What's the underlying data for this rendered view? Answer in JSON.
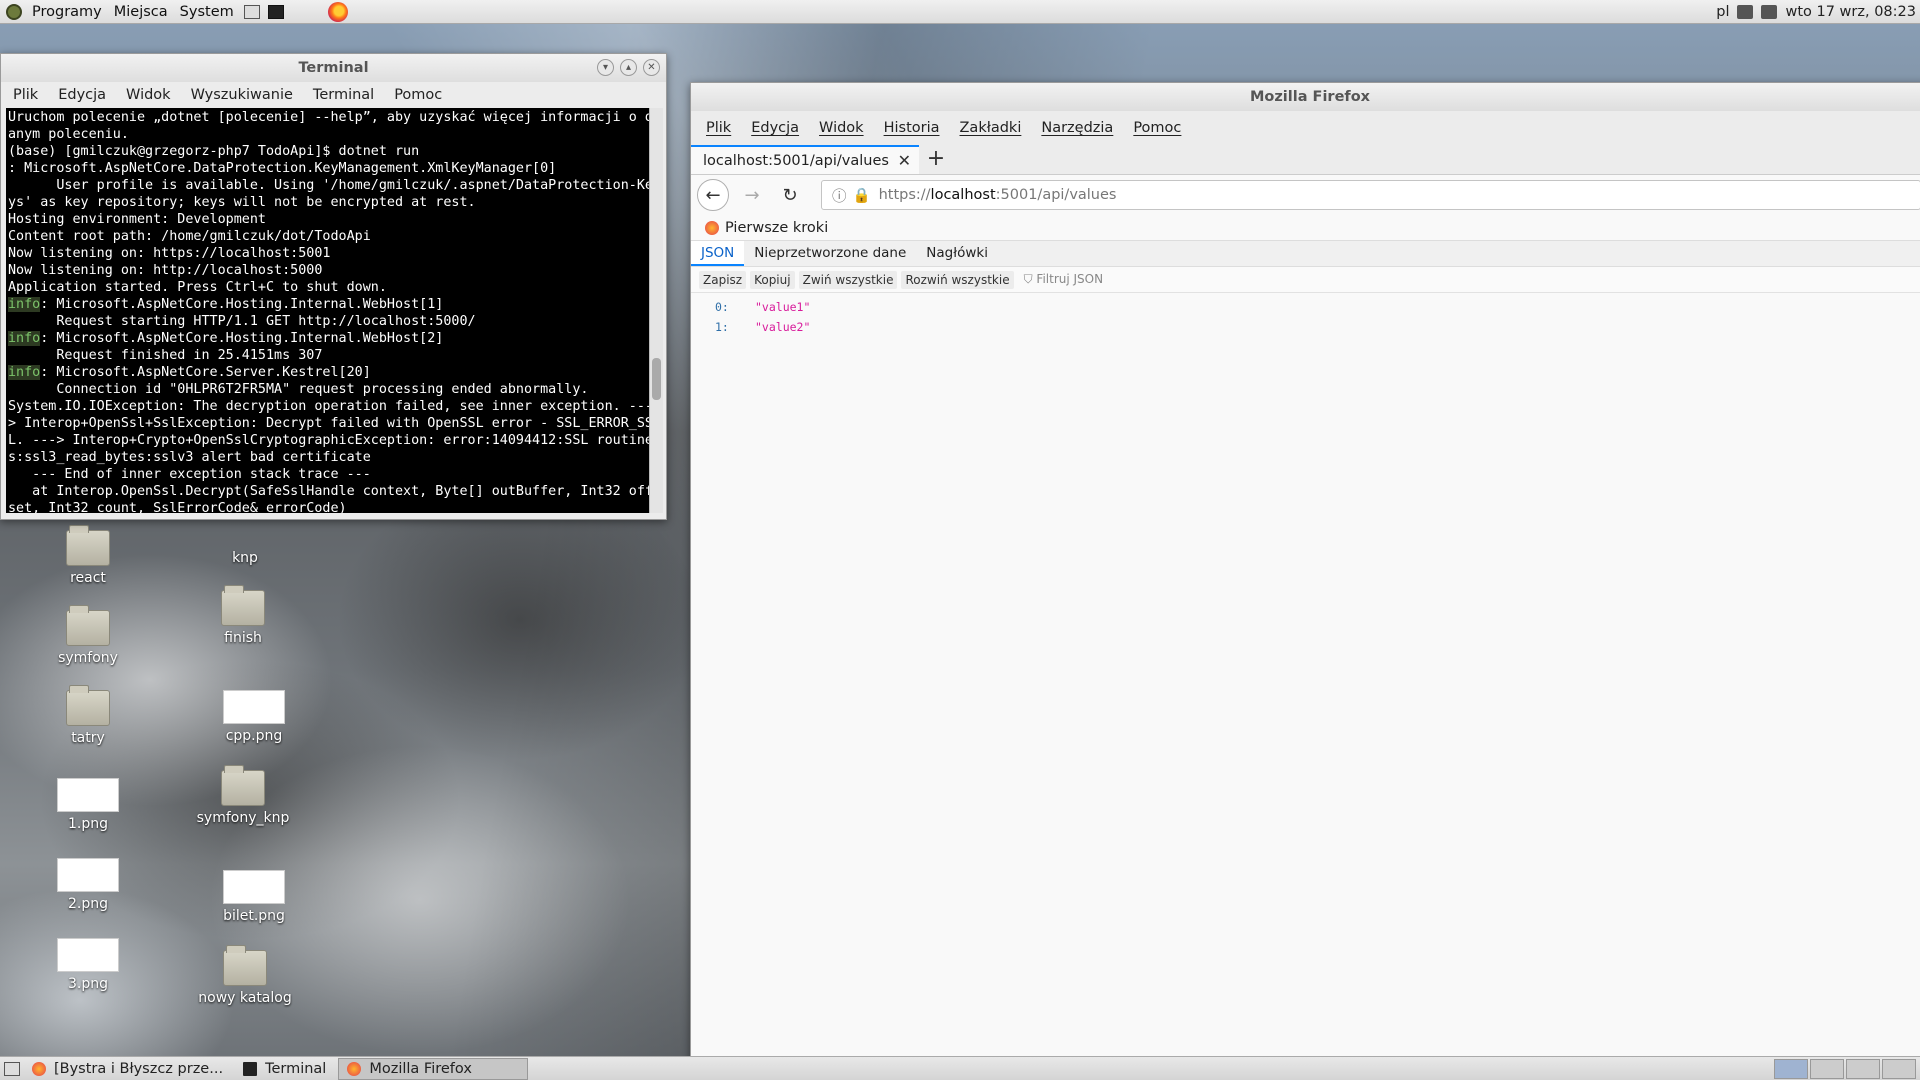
{
  "topbar": {
    "menus": [
      "Programy",
      "Miejsca",
      "System"
    ],
    "keyboard": "pl",
    "clock": "wto 17 wrz, 08:23"
  },
  "terminal": {
    "title": "Terminal",
    "menu": [
      "Plik",
      "Edycja",
      "Widok",
      "Wyszukiwanie",
      "Terminal",
      "Pomoc"
    ],
    "lines": [
      "Uruchom polecenie „dotnet [polecenie] --help”, aby uzyskać więcej informacji o d",
      "anym poleceniu.",
      "(base) [gmilczuk@grzegorz-php7 TodoApi]$ dotnet run",
      ": Microsoft.AspNetCore.DataProtection.KeyManagement.XmlKeyManager[0]",
      "      User profile is available. Using '/home/gmilczuk/.aspnet/DataProtection-Ke",
      "ys' as key repository; keys will not be encrypted at rest.",
      "Hosting environment: Development",
      "Content root path: /home/gmilczuk/dot/TodoApi",
      "Now listening on: https://localhost:5001",
      "Now listening on: http://localhost:5000",
      "Application started. Press Ctrl+C to shut down.",
      "info: Microsoft.AspNetCore.Hosting.Internal.WebHost[1]",
      "      Request starting HTTP/1.1 GET http://localhost:5000/",
      "info: Microsoft.AspNetCore.Hosting.Internal.WebHost[2]",
      "      Request finished in 25.4151ms 307",
      "info: Microsoft.AspNetCore.Server.Kestrel[20]",
      "      Connection id \"0HLPR6T2FR5MA\" request processing ended abnormally.",
      "System.IO.IOException: The decryption operation failed, see inner exception. ---",
      "> Interop+OpenSsl+SslException: Decrypt failed with OpenSSL error - SSL_ERROR_SS",
      "L. ---> Interop+Crypto+OpenSslCryptographicException: error:14094412:SSL routine",
      "s:ssl3_read_bytes:sslv3 alert bad certificate",
      "   --- End of inner exception stack trace ---",
      "   at Interop.OpenSsl.Decrypt(SafeSslHandle context, Byte[] outBuffer, Int32 off",
      "set, Int32 count, SslErrorCode& errorCode)"
    ]
  },
  "firefox": {
    "title": "Mozilla Firefox",
    "menu": [
      "Plik",
      "Edycja",
      "Widok",
      "Historia",
      "Zakładki",
      "Narzędzia",
      "Pomoc"
    ],
    "tab_title": "localhost:5001/api/values",
    "url_scheme": "https://",
    "url_host": "localhost",
    "url_rest": ":5001/api/values",
    "bookmark": "Pierwsze kroki",
    "json_tabs": [
      "JSON",
      "Nieprzetworzone dane",
      "Nagłówki"
    ],
    "json_tools": [
      "Zapisz",
      "Kopiuj",
      "Zwiń wszystkie",
      "Rozwiń wszystkie"
    ],
    "filter_placeholder": "Filtruj JSON",
    "json_rows": [
      {
        "key": "0:",
        "value": "\"value1\""
      },
      {
        "key": "1:",
        "value": "\"value2\""
      }
    ]
  },
  "desktop_icons": [
    {
      "label": "react",
      "kind": "folder"
    },
    {
      "label": "knp",
      "kind": "folder"
    },
    {
      "label": "symfony",
      "kind": "folder"
    },
    {
      "label": "finish",
      "kind": "folder"
    },
    {
      "label": "tatry",
      "kind": "folder"
    },
    {
      "label": "cpp.png",
      "kind": "image"
    },
    {
      "label": "1.png",
      "kind": "image"
    },
    {
      "label": "symfony_knp",
      "kind": "folder"
    },
    {
      "label": "2.png",
      "kind": "image"
    },
    {
      "label": "bilet.png",
      "kind": "image"
    },
    {
      "label": "3.png",
      "kind": "image"
    },
    {
      "label": "nowy katalog",
      "kind": "folder"
    }
  ],
  "taskbar": {
    "tasks": [
      "[Bystra i Błyszcz prze...",
      "Terminal",
      "Mozilla Firefox"
    ]
  },
  "colors": {
    "accent": "#0a84ff",
    "json_value": "#d81b9b",
    "terminal_info": "#7cc36a"
  }
}
